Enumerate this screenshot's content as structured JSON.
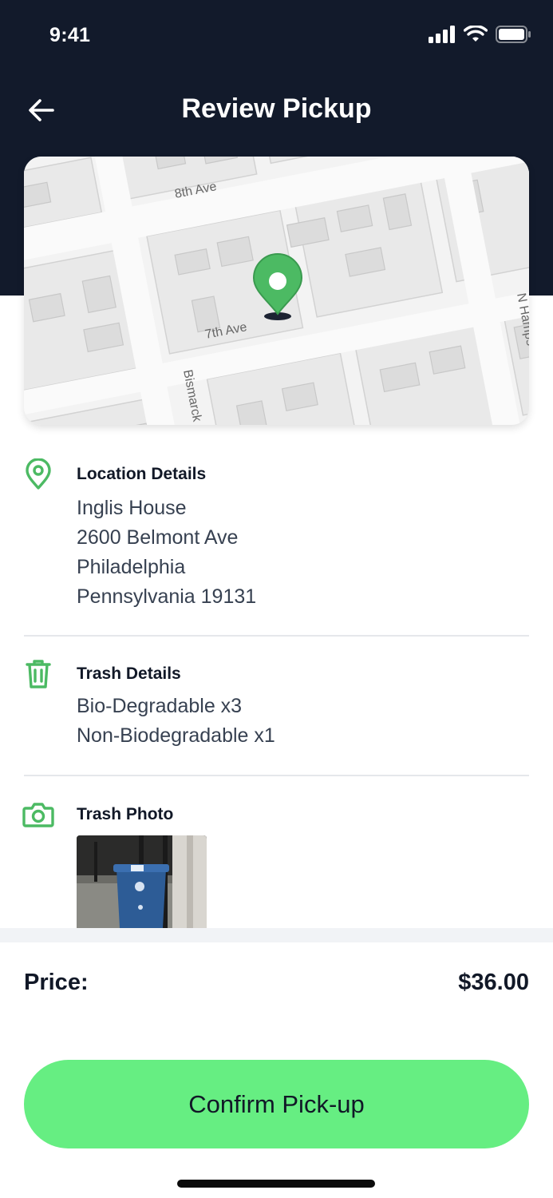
{
  "status_bar": {
    "time": "9:41"
  },
  "header": {
    "title": "Review Pickup"
  },
  "map": {
    "street_labels": [
      "8th Ave",
      "7th Ave",
      "Bismarck",
      "N Hamps"
    ],
    "pin_color": "#4cba63"
  },
  "location": {
    "title": "Location Details",
    "lines": [
      "Inglis House",
      "2600 Belmont Ave",
      "Philadelphia",
      "Pennsylvania 19131"
    ]
  },
  "trash": {
    "title": "Trash Details",
    "lines": [
      "Bio-Degradable x3",
      "Non-Biodegradable x1"
    ]
  },
  "photo": {
    "title": "Trash Photo"
  },
  "price": {
    "label": "Price:",
    "value": "$36.00"
  },
  "confirm": {
    "label": "Confirm Pick-up"
  },
  "colors": {
    "header_bg": "#121a2b",
    "accent": "#4cba63",
    "button": "#66ee82"
  }
}
